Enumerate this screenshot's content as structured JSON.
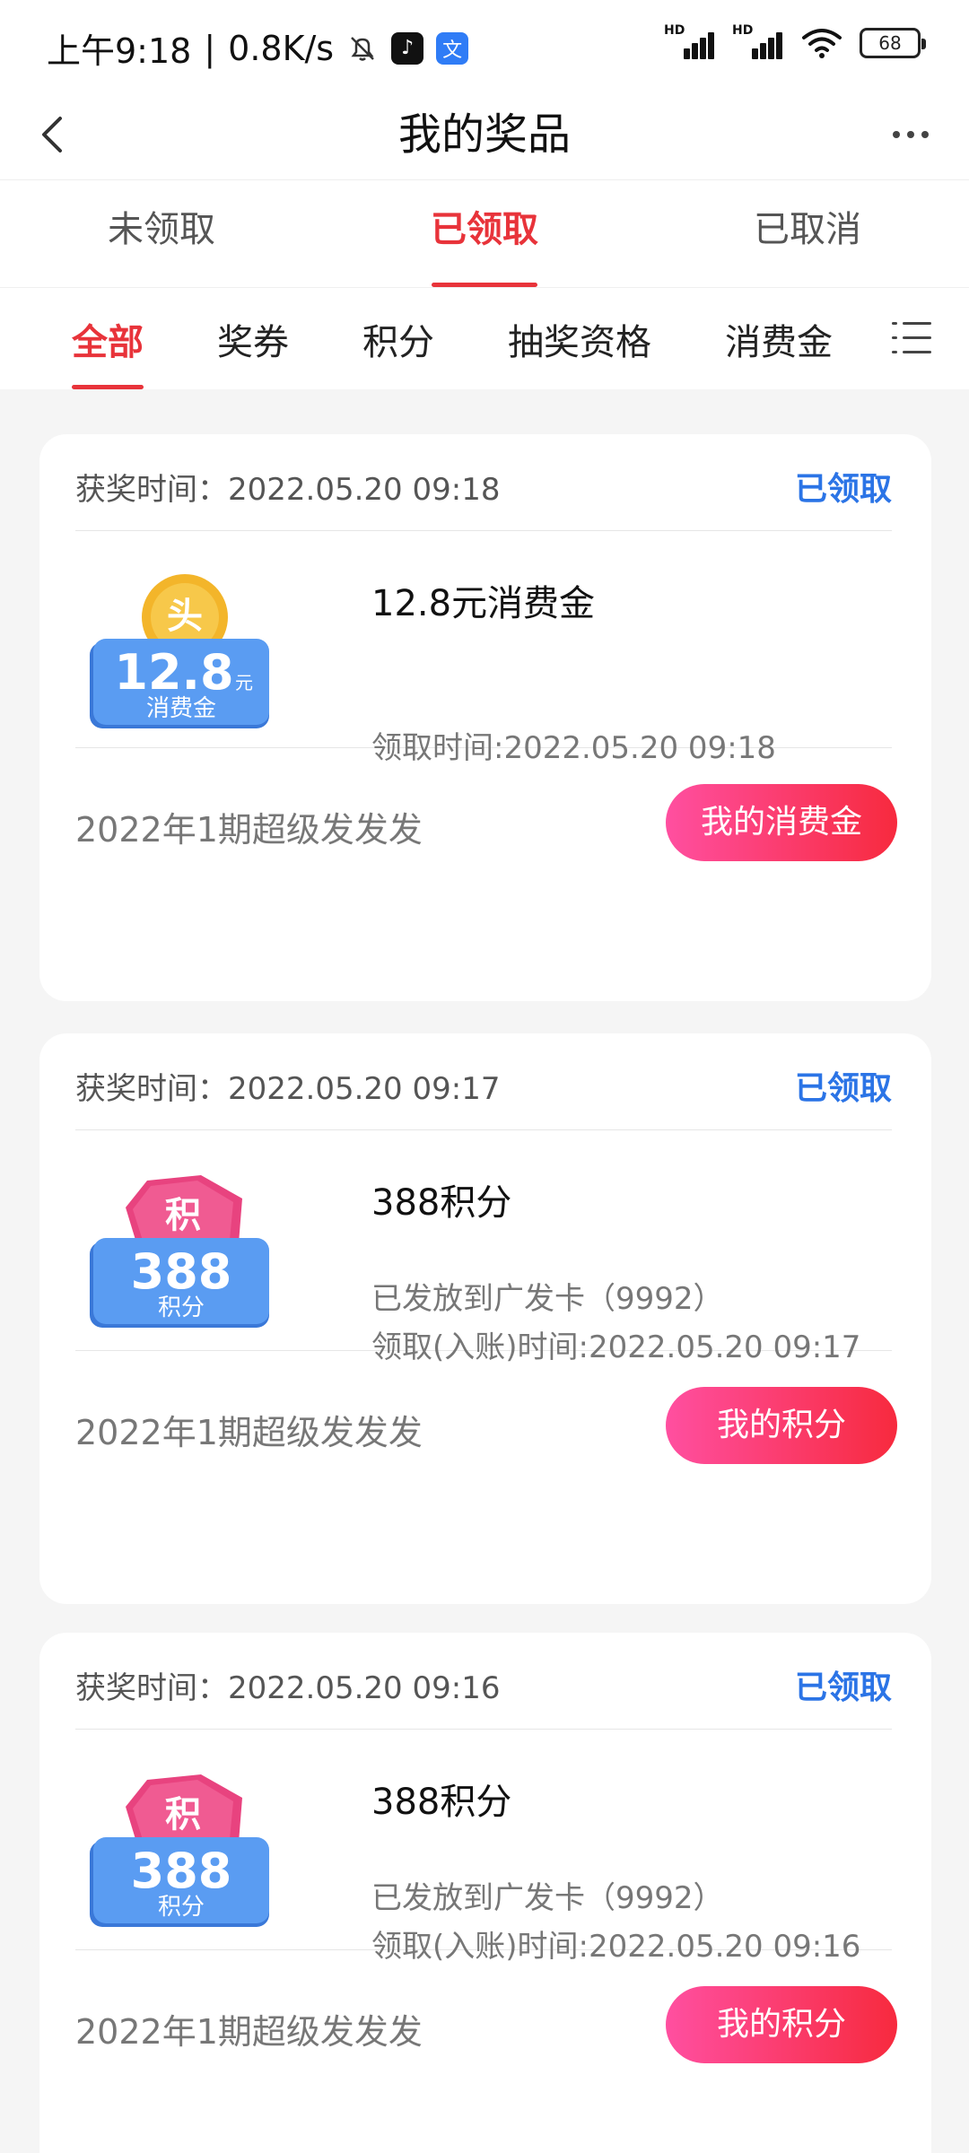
{
  "status_bar": {
    "time": "上午9:18",
    "speed": "0.8K/s",
    "signal1_label": "HD",
    "signal2_label": "HD",
    "battery": "68"
  },
  "header": {
    "title": "我的奖品"
  },
  "status_tabs": [
    "未领取",
    "已领取",
    "已取消"
  ],
  "active_status_tab": "已领取",
  "category_tabs": [
    "全部",
    "奖券",
    "积分",
    "抽奖资格",
    "消费金"
  ],
  "active_category_tab": "全部",
  "cards": [
    {
      "award_time": "获奖时间：2022.05.20 09:18",
      "status": "已领取",
      "prize_badge_amount": "12.8",
      "prize_badge_unit": "元",
      "prize_badge_label": "消费金",
      "prize_badge_top": "头",
      "prize_name": "12.8元消费金",
      "line1": "",
      "line2": "领取时间:2022.05.20 09:18",
      "campaign": "2022年1期超级发发发",
      "button": "我的消费金"
    },
    {
      "award_time": "获奖时间：2022.05.20 09:17",
      "status": "已领取",
      "prize_badge_amount": "388",
      "prize_badge_unit": "",
      "prize_badge_label": "积分",
      "prize_badge_top": "积",
      "prize_name": "388积分",
      "line1": "已发放到广发卡（9992）",
      "line2": "领取(入账)时间:2022.05.20 09:17",
      "campaign": "2022年1期超级发发发",
      "button": "我的积分"
    },
    {
      "award_time": "获奖时间：2022.05.20 09:16",
      "status": "已领取",
      "prize_badge_amount": "388",
      "prize_badge_unit": "",
      "prize_badge_label": "积分",
      "prize_badge_top": "积",
      "prize_name": "388积分",
      "line1": "已发放到广发卡（9992）",
      "line2": "领取(入账)时间:2022.05.20 09:16",
      "campaign": "2022年1期超级发发发",
      "button": "我的积分"
    }
  ],
  "colors": {
    "accent_red": "#e8333a",
    "status_blue": "#2b74e6",
    "button_gradient_start": "#ff4fa0",
    "button_gradient_end": "#f72a3e"
  },
  "icons": [
    "back-arrow-icon",
    "more-icon",
    "list-menu-icon",
    "mute-bell-icon",
    "tiktok-icon",
    "translate-icon",
    "signal-icon",
    "wifi-icon",
    "battery-icon"
  ]
}
